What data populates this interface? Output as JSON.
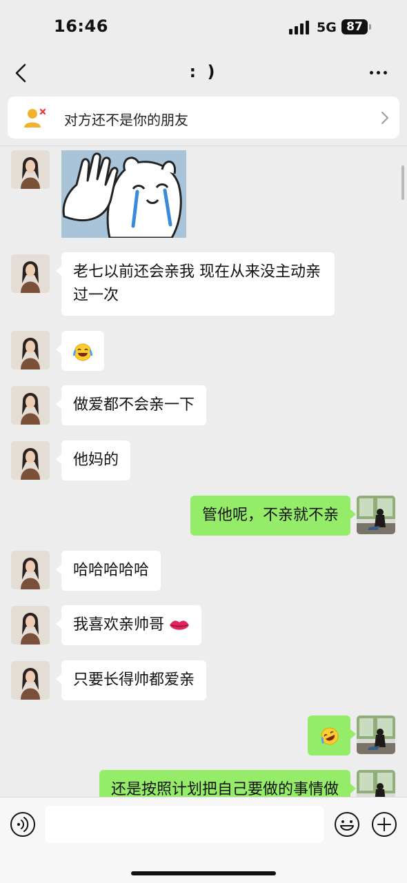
{
  "status_bar": {
    "time": "16:46",
    "network": "5G",
    "battery": "87"
  },
  "nav": {
    "title": ": )"
  },
  "banner": {
    "text": "对方还不是你的朋友"
  },
  "messages": [
    {
      "from": "peer",
      "type": "sticker"
    },
    {
      "from": "peer",
      "text": "老七以前还会亲我 现在从来没主动亲过一次"
    },
    {
      "from": "peer",
      "emoji": "laughing-tears"
    },
    {
      "from": "peer",
      "text": "做爱都不会亲一下"
    },
    {
      "from": "peer",
      "text": "他妈的"
    },
    {
      "from": "me",
      "text": "管他呢，不亲就不亲"
    },
    {
      "from": "peer",
      "text": "哈哈哈哈哈"
    },
    {
      "from": "peer",
      "text": "我喜欢亲帅哥",
      "emoji": "lips"
    },
    {
      "from": "peer",
      "text": "只要长得帅都爱亲"
    },
    {
      "from": "me",
      "emoji": "rolling-laughing"
    },
    {
      "from": "me",
      "text": "还是按照计划把自己要做的事情做"
    }
  ],
  "input": {
    "value": "",
    "placeholder": ""
  },
  "colors": {
    "background": "#ededed",
    "outgoing_bubble": "#95ec69",
    "incoming_bubble": "#ffffff"
  }
}
